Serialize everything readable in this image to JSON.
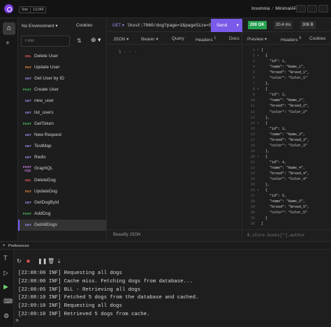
{
  "topbar": {
    "github": {
      "label": "Star",
      "count": "13,043"
    },
    "breadcrumb": {
      "project": "Insomnia",
      "separator": "/",
      "collection": "MinimalAPI"
    }
  },
  "sidebar": {
    "environment": "No Environment ▾",
    "cookies": "Cookies",
    "filter_placeholder": "Filter",
    "items": [
      {
        "method": "DEL",
        "name": "Delete User",
        "color": "#e55b5b"
      },
      {
        "method": "PUT",
        "name": "Update User",
        "color": "#f08a3c"
      },
      {
        "method": "GET",
        "name": "Get User by ID",
        "color": "#9e8ef7"
      },
      {
        "method": "POST",
        "name": "Create User",
        "color": "#49c05b"
      },
      {
        "method": "GET",
        "name": "new_user",
        "color": "#9e8ef7"
      },
      {
        "method": "GET",
        "name": "list_users",
        "color": "#9e8ef7"
      },
      {
        "method": "POST",
        "name": "GetToken",
        "color": "#49c05b"
      },
      {
        "method": "GET",
        "name": "New Request",
        "color": "#9e8ef7"
      },
      {
        "method": "GET",
        "name": "TestMap",
        "color": "#9e8ef7"
      },
      {
        "method": "GET",
        "name": "Redis",
        "color": "#9e8ef7"
      },
      {
        "method": "POST GQL",
        "name": "GraphQL",
        "color": "#c77be0"
      },
      {
        "method": "DEL",
        "name": "DeleteDog",
        "color": "#e55b5b"
      },
      {
        "method": "PUT",
        "name": "UpdateDog",
        "color": "#f08a3c"
      },
      {
        "method": "GET",
        "name": "GetDogById",
        "color": "#9e8ef7"
      },
      {
        "method": "POST",
        "name": "AddDog",
        "color": "#49c05b"
      },
      {
        "method": "GET",
        "name": "GetAllDogs",
        "color": "#9e8ef7",
        "selected": true
      }
    ]
  },
  "request": {
    "method": "GET ▾",
    "url": "lhost:7060/dog?page=1&pageSize=5",
    "send": "Send",
    "tabs": {
      "body": "JSON ▾",
      "auth": "Bearer ▾",
      "query": "Query",
      "headers": "Headers",
      "headers_count": "1",
      "docs": "Docs"
    },
    "editor_line": "1 · · ·",
    "footer": "Beautify JSON"
  },
  "response": {
    "status": "200 OK",
    "time": "20.4 ms",
    "size": "306 B",
    "tabs": {
      "preview": "Preview ▾",
      "headers": "Headers",
      "headers_count": "5",
      "cookies": "Cookies"
    },
    "lines": [
      "[",
      "  {",
      "    \"id\": 1,",
      "    \"name\": \"Name_1\",",
      "    \"breed\": \"Breed_1\",",
      "    \"color\": \"Color_1\"",
      "  },",
      "  {",
      "    \"id\": 2,",
      "    \"name\": \"Name_2\",",
      "    \"breed\": \"Breed_2\",",
      "    \"color\": \"Color_2\"",
      "  },",
      "  {",
      "    \"id\": 3,",
      "    \"name\": \"Name_3\",",
      "    \"breed\": \"Breed_3\",",
      "    \"color\": \"Color_3\"",
      "  },",
      "  {",
      "    \"id\": 4,",
      "    \"name\": \"Name_4\",",
      "    \"breed\": \"Breed_4\",",
      "    \"color\": \"Color_4\"",
      "  },",
      "  {",
      "    \"id\": 5,",
      "    \"name\": \"Name_5\",",
      "    \"breed\": \"Breed_5\",",
      "    \"color\": \"Color_5\"",
      "  }",
      "]"
    ],
    "footer_placeholder": "$.store.books[*].author"
  },
  "console": {
    "header": "Preferences",
    "logs": [
      {
        "time": "22:08:00",
        "level": "INF",
        "message": "Requesting all dogs"
      },
      {
        "time": "22:08:00",
        "level": "INF",
        "message": "Cache miss. Fetching dogs from database..."
      },
      {
        "time": "22:08:05",
        "level": "INF",
        "message": "BLL - Retrieving all dogs"
      },
      {
        "time": "22:08:10",
        "level": "INF",
        "message": "Fetched 5 dogs from the database and cached."
      },
      {
        "time": "22:09:10",
        "level": "INF",
        "message": "Requesting all dogs"
      },
      {
        "time": "22:09:10",
        "level": "INF",
        "message": "Retrieved 5 dogs from cache."
      }
    ]
  }
}
